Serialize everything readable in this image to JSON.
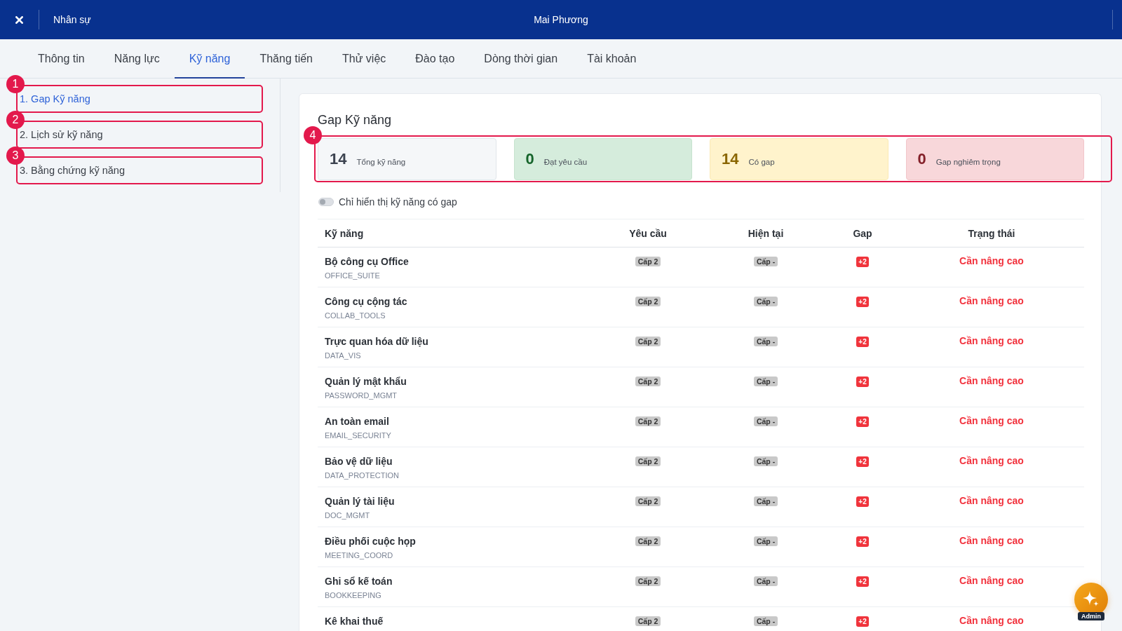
{
  "header": {
    "section": "Nhân sự",
    "title": "Mai Phương"
  },
  "tabs": [
    {
      "label": "Thông tin",
      "selected": false
    },
    {
      "label": "Năng lực",
      "selected": false
    },
    {
      "label": "Kỹ năng",
      "selected": true
    },
    {
      "label": "Thăng tiến",
      "selected": false
    },
    {
      "label": "Thử việc",
      "selected": false
    },
    {
      "label": "Đào tạo",
      "selected": false
    },
    {
      "label": "Dòng thời gian",
      "selected": false
    },
    {
      "label": "Tài khoản",
      "selected": false
    }
  ],
  "sidebar": {
    "items": [
      {
        "label": "1. Gap Kỹ năng",
        "selected": true,
        "callout": "1"
      },
      {
        "label": "2. Lịch sử kỹ năng",
        "selected": false,
        "callout": "2"
      },
      {
        "label": "3. Bằng chứng kỹ năng",
        "selected": false,
        "callout": "3"
      }
    ]
  },
  "panel": {
    "title": "Gap Kỹ năng",
    "stats": {
      "callout": "4",
      "items": [
        {
          "kind": "total",
          "value": "14",
          "label": "Tổng kỹ năng"
        },
        {
          "kind": "met",
          "value": "0",
          "label": "Đạt yêu cầu"
        },
        {
          "kind": "gap",
          "value": "14",
          "label": "Có gap"
        },
        {
          "kind": "critical",
          "value": "0",
          "label": "Gap nghiêm trọng"
        }
      ]
    },
    "filter": {
      "label": "Chỉ hiển thị kỹ năng có gap",
      "on": false
    },
    "table": {
      "columns": [
        "Kỹ năng",
        "Yêu cầu",
        "Hiện tại",
        "Gap",
        "Trạng thái"
      ],
      "rows": [
        {
          "name": "Bộ công cụ Office",
          "code": "OFFICE_SUITE",
          "required": "Cấp 2",
          "current": "Cấp -",
          "gap": "+2",
          "status": "Cần nâng cao"
        },
        {
          "name": "Công cụ cộng tác",
          "code": "COLLAB_TOOLS",
          "required": "Cấp 2",
          "current": "Cấp -",
          "gap": "+2",
          "status": "Cần nâng cao"
        },
        {
          "name": "Trực quan hóa dữ liệu",
          "code": "DATA_VIS",
          "required": "Cấp 2",
          "current": "Cấp -",
          "gap": "+2",
          "status": "Cần nâng cao"
        },
        {
          "name": "Quản lý mật khẩu",
          "code": "PASSWORD_MGMT",
          "required": "Cấp 2",
          "current": "Cấp -",
          "gap": "+2",
          "status": "Cần nâng cao"
        },
        {
          "name": "An toàn email",
          "code": "EMAIL_SECURITY",
          "required": "Cấp 2",
          "current": "Cấp -",
          "gap": "+2",
          "status": "Cần nâng cao"
        },
        {
          "name": "Bảo vệ dữ liệu",
          "code": "DATA_PROTECTION",
          "required": "Cấp 2",
          "current": "Cấp -",
          "gap": "+2",
          "status": "Cần nâng cao"
        },
        {
          "name": "Quản lý tài liệu",
          "code": "DOC_MGMT",
          "required": "Cấp 2",
          "current": "Cấp -",
          "gap": "+2",
          "status": "Cần nâng cao"
        },
        {
          "name": "Điều phối cuộc họp",
          "code": "MEETING_COORD",
          "required": "Cấp 2",
          "current": "Cấp -",
          "gap": "+2",
          "status": "Cần nâng cao"
        },
        {
          "name": "Ghi sổ kế toán",
          "code": "BOOKKEEPING",
          "required": "Cấp 2",
          "current": "Cấp -",
          "gap": "+2",
          "status": "Cần nâng cao"
        },
        {
          "name": "Kê khai thuế",
          "required": "Cấp 2",
          "current": "Cấp -",
          "gap": "+2",
          "status": "Cần nâng cao"
        }
      ]
    }
  },
  "assistant": {
    "label": "Admin"
  }
}
